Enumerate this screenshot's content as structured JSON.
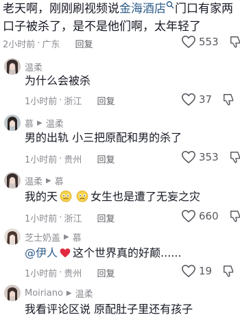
{
  "top_comment": {
    "text_before": "老天啊，刚刚刷视频说",
    "link_text": "金海酒店",
    "text_after": "门口有家两口子被杀了，是不是他们啊，太年轻了",
    "time": "2小时前",
    "location": "广东",
    "reply_label": "回复",
    "likes": "553"
  },
  "replies": [
    {
      "user": "温柔",
      "reply_to": "",
      "text": "为什么会被杀",
      "time": "1小时前",
      "location": "浙江",
      "reply_label": "回复",
      "likes": "37"
    },
    {
      "user": "慕",
      "reply_to": "温柔",
      "text": "男的出轨 小三把原配和男的杀了",
      "time": "1小时前",
      "location": "贵州",
      "reply_label": "回复",
      "likes": "353"
    },
    {
      "user": "温柔",
      "reply_to": "慕",
      "text_before": "我的天",
      "text_after": "女生也是遭了无妄之灾",
      "time": "1小时前",
      "location": "浙江",
      "reply_label": "回复",
      "likes": "660"
    },
    {
      "user": "芝士奶盖",
      "reply_to": "慕",
      "mention": "@伊人",
      "text_after": "这个世界真的好颠......",
      "time": "1小时前",
      "location": "贵州",
      "reply_label": "回复",
      "likes": "19"
    },
    {
      "user": "Moiriano",
      "reply_to": "温柔",
      "text": "我看评论区说 原配肚子里还有孩子"
    }
  ],
  "icons": {
    "heart": "heart-outline-icon",
    "thumb": "thumb-down-icon",
    "reply_arrow": "triangle-right-icon",
    "emoji": "worried-face-icon",
    "red_heart": "red-heart-icon",
    "search": "search-icon"
  },
  "colors": {
    "link": "#2e5c8a",
    "meta": "#8a8b91",
    "text": "#161823",
    "heart_red": "#e02b3f"
  }
}
